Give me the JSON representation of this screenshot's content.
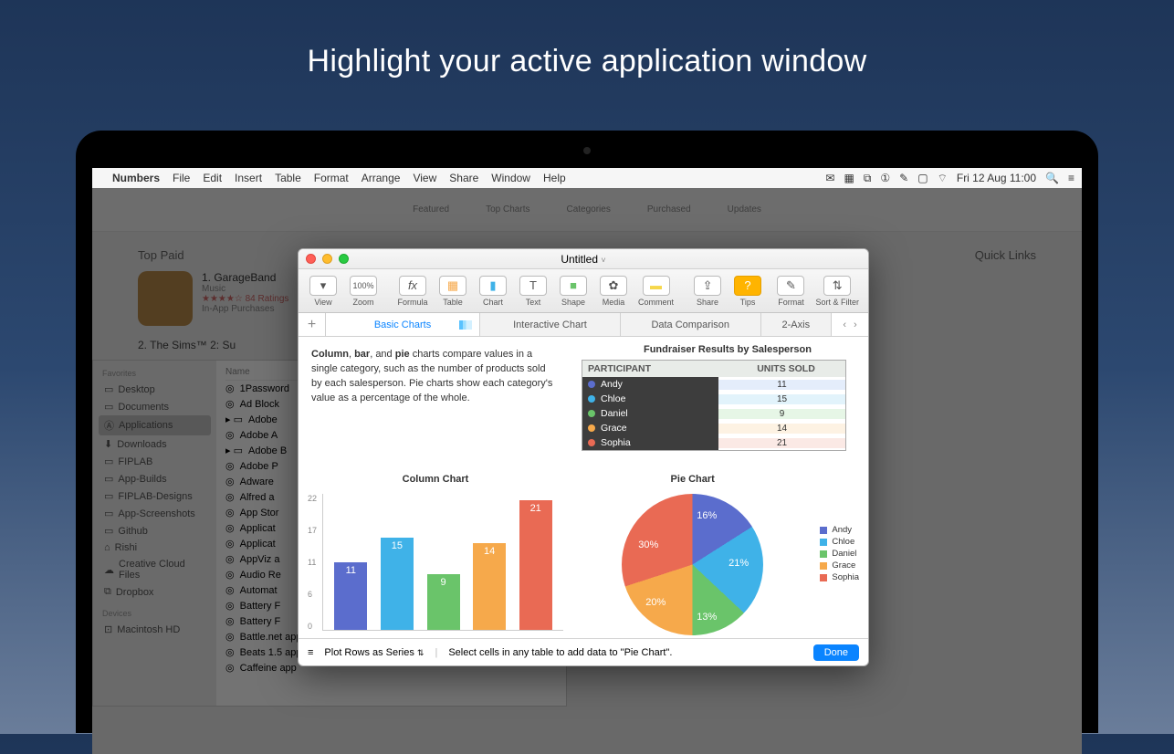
{
  "hero": "Highlight your active application window",
  "menubar": {
    "app": "Numbers",
    "items": [
      "File",
      "Edit",
      "Insert",
      "Table",
      "Format",
      "Arrange",
      "View",
      "Share",
      "Window",
      "Help"
    ],
    "datetime": "Fri 12 Aug  11:00"
  },
  "app_store": {
    "tabs": [
      "Featured",
      "Top Charts",
      "Categories",
      "Purchased",
      "Updates"
    ],
    "section": "Top Paid",
    "quick_links": "Quick Links",
    "items": [
      {
        "rank": "1. GarageBand",
        "cat": "Music",
        "ratings": "84 Ratings",
        "note": "In-App Purchases"
      },
      {
        "rank": "2. The Sims™ 2: Su"
      }
    ]
  },
  "finder": {
    "favorites_label": "Favorites",
    "devices_label": "Devices",
    "sidebar": [
      "Desktop",
      "Documents",
      "Applications",
      "Downloads",
      "FIPLAB",
      "App-Builds",
      "FIPLAB-Designs",
      "App-Screenshots",
      "Github",
      "Rishi",
      "Creative Cloud Files",
      "Dropbox"
    ],
    "devices": [
      "Macintosh HD"
    ],
    "selected": "Applications",
    "header": "Name",
    "rows": [
      "1Password",
      "Ad Block",
      "Adobe",
      "Adobe A",
      "Adobe B",
      "Adobe P",
      "Adware",
      "Alfred a",
      "App Stor",
      "Applicat",
      "Applicat",
      "AppViz a",
      "Audio Re",
      "Automat",
      "Battery F",
      "Battery F",
      "Battle.net app",
      "Beats 1.5 app",
      "Caffeine app"
    ]
  },
  "numbers": {
    "title": "Untitled",
    "toolbar": [
      {
        "label": "View",
        "icon": "▾"
      },
      {
        "label": "Zoom",
        "icon": "100%"
      },
      {
        "label": "Formula",
        "icon": "fx"
      },
      {
        "label": "Table",
        "icon": "▦"
      },
      {
        "label": "Chart",
        "icon": "▮"
      },
      {
        "label": "Text",
        "icon": "T"
      },
      {
        "label": "Shape",
        "icon": "■"
      },
      {
        "label": "Media",
        "icon": "✿"
      },
      {
        "label": "Comment",
        "icon": "▬"
      },
      {
        "label": "Share",
        "icon": "⇪"
      },
      {
        "label": "Tips",
        "icon": "?"
      },
      {
        "label": "Format",
        "icon": "✎"
      },
      {
        "label": "Sort & Filter",
        "icon": "⇅"
      }
    ],
    "tabs": [
      "Basic Charts",
      "Interactive Chart",
      "Data Comparison",
      "2-Axis"
    ],
    "description": "Column, bar, and pie charts compare values in a single category, such as the number of products sold by each salesperson. Pie charts show each category's value as a percentage of the whole.",
    "table_title": "Fundraiser Results by Salesperson",
    "table_headers": [
      "PARTICIPANT",
      "UNITS SOLD"
    ],
    "participants": [
      {
        "name": "Andy",
        "units": 11,
        "color": "#5b6dcd"
      },
      {
        "name": "Chloe",
        "units": 15,
        "color": "#3fb2e8"
      },
      {
        "name": "Daniel",
        "units": 9,
        "color": "#6ac46a"
      },
      {
        "name": "Grace",
        "units": 14,
        "color": "#f6a94b"
      },
      {
        "name": "Sophia",
        "units": 21,
        "color": "#e96a54"
      }
    ],
    "column_chart_title": "Column Chart",
    "pie_chart_title": "Pie Chart",
    "y_ticks": [
      "22",
      "17",
      "11",
      "6",
      "0"
    ],
    "pie_labels": [
      "16%",
      "21%",
      "13%",
      "20%",
      "30%"
    ],
    "footer_select": "Plot Rows as Series",
    "footer_hint": "Select cells in any table to add data to \"Pie Chart\".",
    "done": "Done"
  },
  "chart_data": [
    {
      "type": "bar",
      "title": "Column Chart",
      "categories": [
        "Andy",
        "Chloe",
        "Daniel",
        "Grace",
        "Sophia"
      ],
      "values": [
        11,
        15,
        9,
        14,
        21
      ],
      "ylim": [
        0,
        22
      ],
      "ylabel": "",
      "xlabel": ""
    },
    {
      "type": "pie",
      "title": "Pie Chart",
      "series": [
        {
          "name": "Units",
          "values": [
            16,
            21,
            13,
            20,
            30
          ]
        }
      ],
      "categories": [
        "Andy",
        "Chloe",
        "Daniel",
        "Grace",
        "Sophia"
      ],
      "labels_pct": [
        "16%",
        "21%",
        "13%",
        "20%",
        "30%"
      ]
    },
    {
      "type": "table",
      "title": "Fundraiser Results by Salesperson",
      "columns": [
        "PARTICIPANT",
        "UNITS SOLD"
      ],
      "rows": [
        [
          "Andy",
          11
        ],
        [
          "Chloe",
          15
        ],
        [
          "Daniel",
          9
        ],
        [
          "Grace",
          14
        ],
        [
          "Sophia",
          21
        ]
      ]
    }
  ]
}
